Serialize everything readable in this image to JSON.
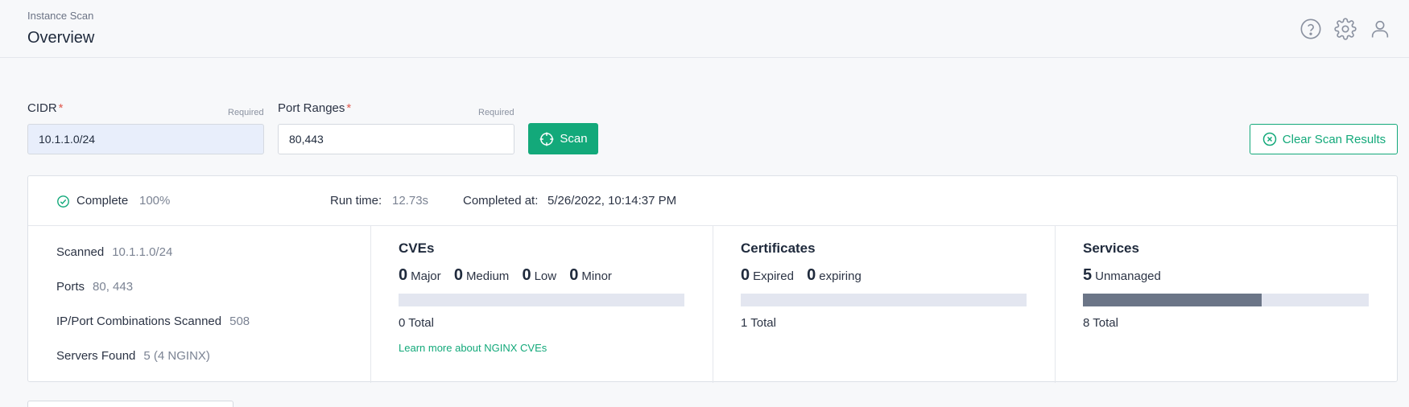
{
  "header": {
    "breadcrumb": "Instance Scan",
    "title": "Overview",
    "icons": [
      "help-icon",
      "gear-icon",
      "user-icon"
    ]
  },
  "form": {
    "cidr": {
      "label": "CIDR",
      "required_mark": "*",
      "required_hint": "Required",
      "value": "10.1.1.0/24"
    },
    "ports": {
      "label": "Port Ranges",
      "required_mark": "*",
      "required_hint": "Required",
      "value": "80,443"
    },
    "scan_label": "Scan",
    "clear_label": "Clear Scan Results"
  },
  "status": {
    "state": "Complete",
    "percent": "100%",
    "runtime_label": "Run time:",
    "runtime_value": "12.73s",
    "completed_label": "Completed at:",
    "completed_value": "5/26/2022, 10:14:37 PM"
  },
  "summary": {
    "scanned_label": "Scanned",
    "scanned_value": "10.1.1.0/24",
    "ports_label": "Ports",
    "ports_value": "80, 443",
    "combos_label": "IP/Port Combinations Scanned",
    "combos_value": "508",
    "servers_label": "Servers Found",
    "servers_value": "5 (4 NGINX)"
  },
  "cves": {
    "title": "CVEs",
    "major": "0",
    "major_label": "Major",
    "medium": "0",
    "medium_label": "Medium",
    "low": "0",
    "low_label": "Low",
    "minor": "0",
    "minor_label": "Minor",
    "total": "0 Total",
    "progress": 0,
    "link": "Learn more about NGINX CVEs"
  },
  "certificates": {
    "title": "Certificates",
    "expired": "0",
    "expired_label": "Expired",
    "expiring": "0",
    "expiring_label": "expiring",
    "total": "1 Total",
    "progress": 0
  },
  "services": {
    "title": "Services",
    "unmanaged": "5",
    "unmanaged_label": "Unmanaged",
    "total": "8 Total",
    "progress": 0.625
  },
  "colors": {
    "accent": "#13a97a",
    "required_star": "#e05a4f",
    "bar_track": "#e3e6f0",
    "bar_fill": "#6b7587"
  }
}
